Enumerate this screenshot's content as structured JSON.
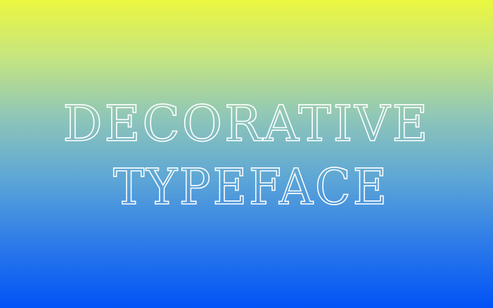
{
  "background": {
    "top_color": "#ebf73f",
    "bottom_color": "#0152f7"
  },
  "title": {
    "line1": "DECORATIVE",
    "line2": "TYPEFACE",
    "color": "#ffffff"
  }
}
